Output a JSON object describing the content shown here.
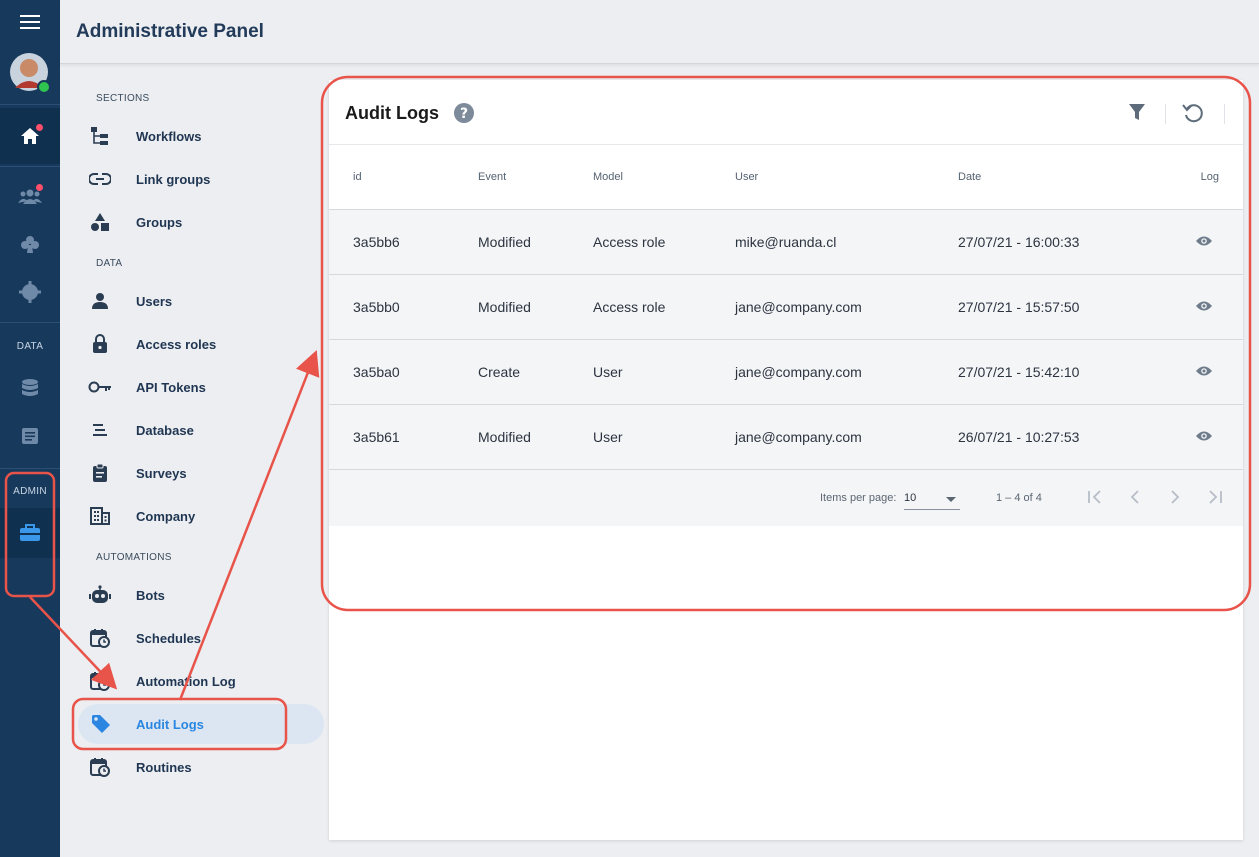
{
  "header": {
    "title": "Administrative Panel"
  },
  "rail": {
    "data_label": "DATA",
    "admin_label": "ADMIN"
  },
  "menu": {
    "sections_label": "SECTIONS",
    "data_label": "DATA",
    "automations_label": "AUTOMATIONS",
    "items": [
      {
        "label": "Workflows"
      },
      {
        "label": "Link groups"
      },
      {
        "label": "Groups"
      },
      {
        "label": "Users"
      },
      {
        "label": "Access roles"
      },
      {
        "label": "API Tokens"
      },
      {
        "label": "Database"
      },
      {
        "label": "Surveys"
      },
      {
        "label": "Company"
      },
      {
        "label": "Bots"
      },
      {
        "label": "Schedules"
      },
      {
        "label": "Automation Log"
      },
      {
        "label": "Audit Logs"
      },
      {
        "label": "Routines"
      }
    ]
  },
  "card": {
    "title": "Audit Logs",
    "columns": [
      "id",
      "Event",
      "Model",
      "User",
      "Date",
      "Log"
    ],
    "rows": [
      {
        "id": "3a5bb6",
        "event": "Modified",
        "model": "Access role",
        "user": "mike@ruanda.cl",
        "date": "27/07/21 - 16:00:33"
      },
      {
        "id": "3a5bb0",
        "event": "Modified",
        "model": "Access role",
        "user": "jane@company.com",
        "date": "27/07/21 - 15:57:50"
      },
      {
        "id": "3a5ba0",
        "event": "Create",
        "model": "User",
        "user": "jane@company.com",
        "date": "27/07/21 - 15:42:10"
      },
      {
        "id": "3a5b61",
        "event": "Modified",
        "model": "User",
        "user": "jane@company.com",
        "date": "26/07/21 - 10:27:53"
      }
    ],
    "pager": {
      "items_per_page_label": "Items per page:",
      "items_per_page_value": "10",
      "range": "1 – 4 of 4"
    }
  },
  "colors": {
    "rail": "#17395c",
    "accent": "#2a86e0",
    "annotation": "#e8534a",
    "selected_bg": "#dbe6f2"
  }
}
